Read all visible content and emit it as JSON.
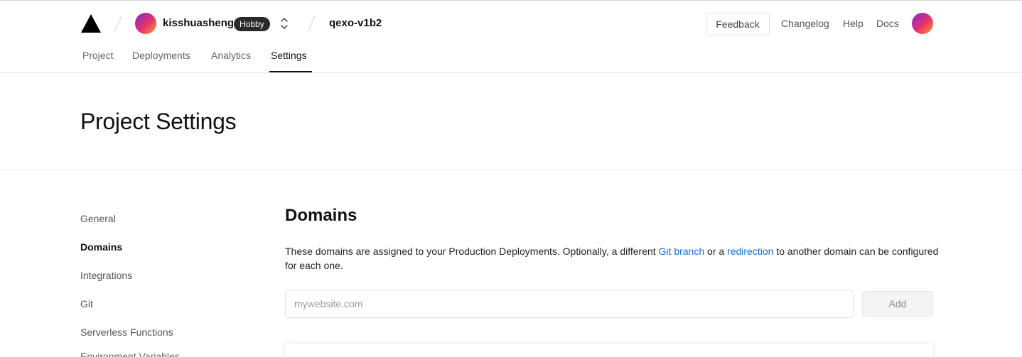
{
  "header": {
    "team": {
      "name": "kisshuasheng",
      "plan_badge": "Hobby",
      "avatar_icon": "avatar-gradient"
    },
    "project": {
      "name": "qexo-v1b2"
    },
    "actions": {
      "feedback_label": "Feedback",
      "changelog_label": "Changelog",
      "help_label": "Help",
      "docs_label": "Docs"
    },
    "tabs": [
      {
        "label": "Project"
      },
      {
        "label": "Deployments"
      },
      {
        "label": "Analytics"
      },
      {
        "label": "Settings",
        "active": true
      }
    ]
  },
  "page": {
    "title": "Project Settings"
  },
  "sidebar": {
    "items": [
      {
        "label": "General"
      },
      {
        "label": "Domains",
        "active": true
      },
      {
        "label": "Integrations"
      },
      {
        "label": "Git"
      },
      {
        "label": "Serverless Functions"
      },
      {
        "label": "Environment Variables"
      }
    ]
  },
  "domains": {
    "title": "Domains",
    "description": {
      "part1": "These domains are assigned to your Production Deployments. Optionally, a different ",
      "link1": "Git branch",
      "part2": " or a ",
      "link2": "redirection",
      "part3": " to another domain can be configured for each one."
    },
    "input": {
      "placeholder": "mywebsite.com",
      "value": ""
    },
    "add_label": "Add"
  },
  "colors": {
    "accent_link": "#0a6fdb",
    "badge_bg": "#2a2a2a",
    "text_primary": "#111111"
  }
}
